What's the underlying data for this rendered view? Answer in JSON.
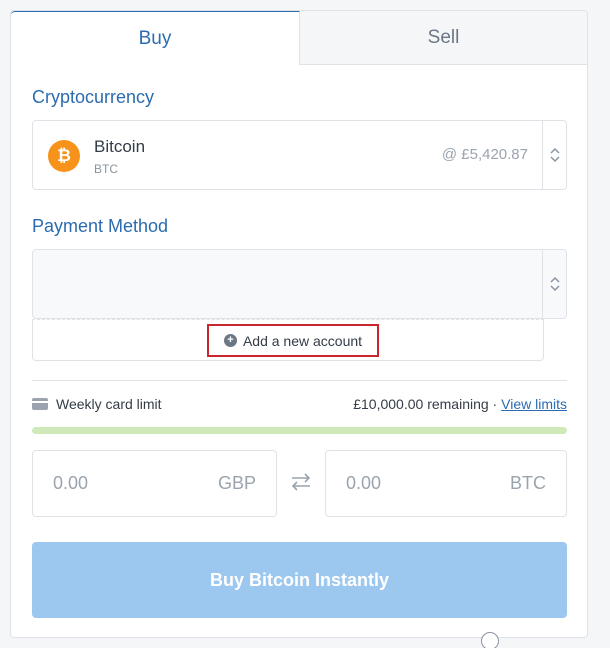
{
  "tabs": {
    "buy": "Buy",
    "sell": "Sell"
  },
  "crypto": {
    "label": "Cryptocurrency",
    "name": "Bitcoin",
    "code": "BTC",
    "logo_symbol": "₿",
    "price": "@ £5,420.87"
  },
  "payment": {
    "label": "Payment Method",
    "add_account": "Add a new account"
  },
  "limits": {
    "label": "Weekly card limit",
    "remaining": "£10,000.00 remaining",
    "separator": " · ",
    "view_limits": "View limits",
    "progress_fraction": 1.0
  },
  "amounts": {
    "fiat_value": "0.00",
    "fiat_currency": "GBP",
    "crypto_value": "0.00",
    "crypto_currency": "BTC"
  },
  "buy_button": "Buy Bitcoin Instantly",
  "colors": {
    "accent": "#2b6cb0",
    "bitcoin": "#f7931a",
    "highlight_border": "#c8262c",
    "button_disabled": "#9cc7ee",
    "progress": "#cfe9b8"
  },
  "icons": [
    "bitcoin-icon",
    "stepper-icon",
    "plus-circle-icon",
    "credit-card-icon",
    "swap-arrows-icon"
  ]
}
